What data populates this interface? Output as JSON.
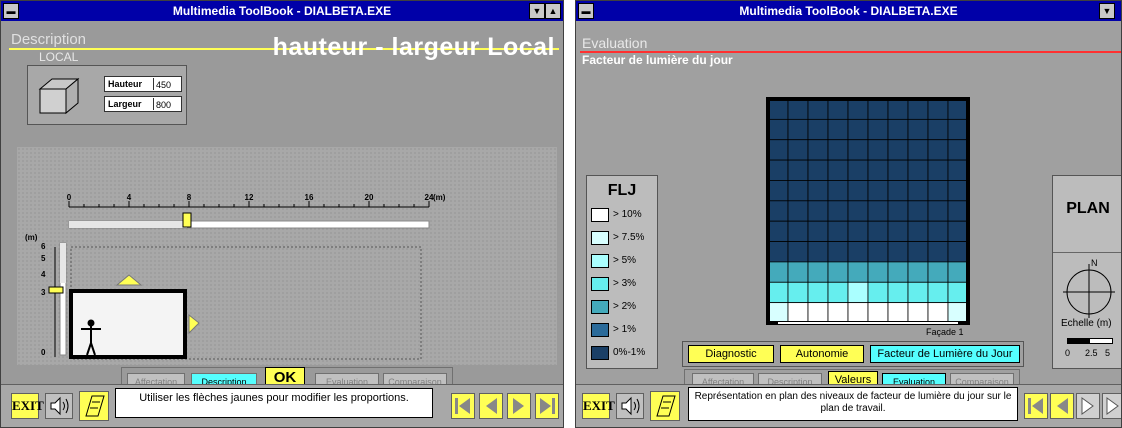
{
  "left": {
    "title": "Multimedia ToolBook - DIALBETA.EXE",
    "section": "Description",
    "subsection": "LOCAL",
    "heading": "hauteur - largeur Local",
    "fields": [
      {
        "label": "Hauteur",
        "value": "450"
      },
      {
        "label": "Largeur",
        "value": "800"
      }
    ],
    "ruler": {
      "ticks": [
        "0",
        "4",
        "8",
        "12",
        "16",
        "20",
        "24"
      ],
      "unit": "(m)"
    },
    "vruler": {
      "unit": "(m)",
      "ticks": [
        "6",
        "5",
        "4",
        "3",
        "0"
      ]
    },
    "tabs": [
      "Affectation",
      "Description",
      "OK",
      "Evaluation",
      "Comparaison"
    ],
    "message": "Utiliser les flèches jaunes pour modifier les proportions.",
    "exit_label": "EXIT"
  },
  "right": {
    "title": "Multimedia ToolBook - DIALBETA.EXE",
    "section": "Evaluation",
    "subtitle": "Facteur de lumière du jour",
    "legend_title": "FLJ",
    "legend": [
      {
        "label": "> 10%",
        "color": "#ffffff"
      },
      {
        "label": "> 7.5%",
        "color": "#d8ffff"
      },
      {
        "label": "> 5%",
        "color": "#aaffff"
      },
      {
        "label": "> 3%",
        "color": "#66eeee"
      },
      {
        "label": "> 2%",
        "color": "#44aabb"
      },
      {
        "label": "> 1%",
        "color": "#2a6a99"
      },
      {
        "label": "0%-1%",
        "color": "#1a3f66"
      }
    ],
    "facade_label": "Façade 1",
    "plan_label": "PLAN",
    "north_label": "N",
    "scale_label": "Echelle (m)",
    "scale_ticks": [
      "0",
      "2.5",
      "5"
    ],
    "eval_tabs": [
      "Diagnostic",
      "Autonomie",
      "Facteur de Lumière du Jour"
    ],
    "tabs": [
      "Affectation",
      "Description",
      "Valeurs",
      "Evaluation",
      "Comparaison"
    ],
    "message": "Représentation en plan des niveaux de facteur de lumière du jour sur le plan de travail.",
    "exit_label": "EXIT"
  }
}
